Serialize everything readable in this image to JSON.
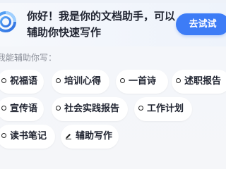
{
  "status_fragment": "",
  "header": {
    "greeting_line1": "你好！我是你的文档助手，可以",
    "greeting_line2": "辅助你快速写作",
    "try_button_label": "去试试"
  },
  "section_label": "我能辅助你写：",
  "chips": [
    {
      "label": "祝福语",
      "icon": "circle-icon"
    },
    {
      "label": "培训心得",
      "icon": "circle-icon"
    },
    {
      "label": "一首诗",
      "icon": "circle-icon"
    },
    {
      "label": "述职报告",
      "icon": "circle-icon"
    },
    {
      "label": "宣传语",
      "icon": "circle-icon"
    },
    {
      "label": "社会实践报告",
      "icon": "circle-icon"
    },
    {
      "label": "工作计划",
      "icon": "circle-icon"
    },
    {
      "label": "读书笔记",
      "icon": "circle-icon"
    },
    {
      "label": "辅助写作",
      "icon": "pen-icon"
    }
  ],
  "colors": {
    "accent": "#3d7cf6",
    "text": "#1f2330",
    "muted": "#8b8f99",
    "background": "#f4f6fa"
  }
}
